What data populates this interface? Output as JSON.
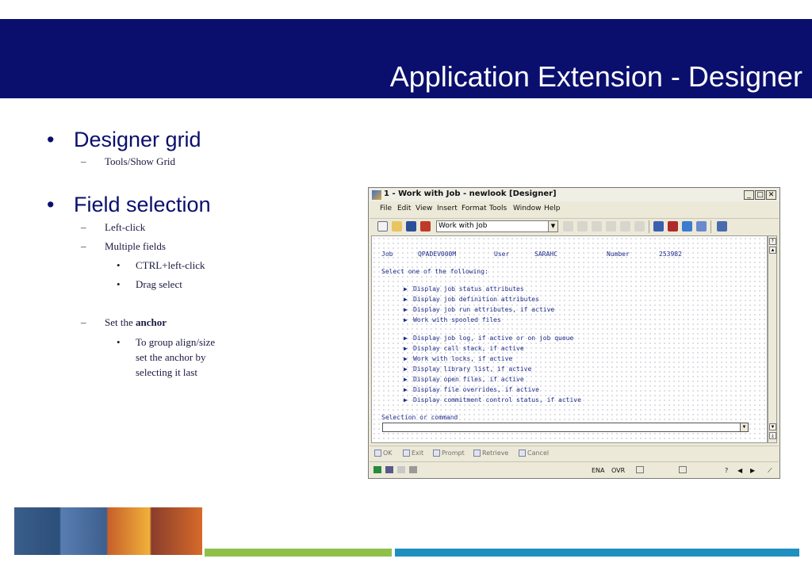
{
  "slide": {
    "title": "Application Extension - Designer",
    "colors": {
      "banner": "#0a0f6e",
      "green_bar": "#8fc04a",
      "blue_bar": "#1f8fc0"
    }
  },
  "bullets": {
    "designer_grid": {
      "label": "Designer grid",
      "sub": "Tools/Show Grid"
    },
    "field_selection": {
      "label": "Field selection",
      "left_click": "Left-click",
      "multiple_fields": "Multiple fields",
      "ctrl_click": "CTRL+left-click",
      "drag_select": "Drag select",
      "set_the": "Set the",
      "anchor": "anchor",
      "group_line1": "To group align/size",
      "group_line2": "set the anchor by",
      "group_line3": "selecting it last"
    },
    "bullet_glyph": "•",
    "dash_glyph": "–"
  },
  "window": {
    "title": "1 - Work with Job - newlook [Designer]",
    "controls": {
      "minimize": "_",
      "maximize": "□",
      "close": "✕"
    },
    "menus": [
      "File",
      "Edit",
      "View",
      "Insert",
      "Format",
      "Tools",
      "Window",
      "Help"
    ],
    "screen_selector": "Work with Job",
    "screen": {
      "job_label": "Job",
      "job_value": "QPADEV000M",
      "user_label": "User",
      "user_value": "SARAHC",
      "number_label": "Number",
      "number_value": "253982",
      "prompt": "Select one of the following:",
      "options_group1": [
        "Display job status attributes",
        "Display job definition attributes",
        "Display job run attributes, if active",
        "Work with spooled files"
      ],
      "options_group2": [
        "Display job log, if active or on job queue",
        "Display call stack, if active",
        "Work with locks, if active",
        "Display library list, if active",
        "Display open files, if active",
        "Display file overrides, if active",
        "Display commitment control status, if active"
      ],
      "option_marker": "▶",
      "command_label": "Selection or command"
    },
    "function_keys": [
      "OK",
      "Exit",
      "Prompt",
      "Retrieve",
      "Cancel"
    ],
    "status": {
      "ena": "ENA",
      "ovr": "OVR",
      "help": "?"
    }
  }
}
